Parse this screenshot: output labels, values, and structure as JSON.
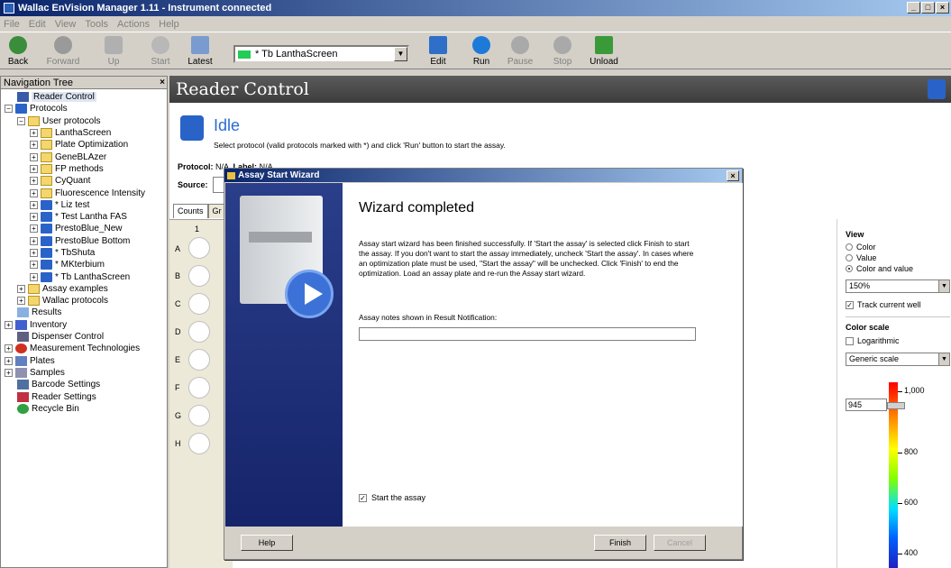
{
  "window": {
    "title": "Wallac EnVision Manager 1.11 - Instrument connected",
    "controls": [
      "_",
      "□",
      "×"
    ]
  },
  "menu": [
    "File",
    "Edit",
    "View",
    "Tools",
    "Actions",
    "Help"
  ],
  "toolbar": {
    "back": "Back",
    "forward": "Forward",
    "up": "Up",
    "start": "Start",
    "latest": "Latest",
    "protocol_select": "* Tb LanthaScreen",
    "edit": "Edit",
    "run": "Run",
    "pause": "Pause",
    "stop": "Stop",
    "unload": "Unload"
  },
  "nav": {
    "title": "Navigation Tree",
    "close": "×",
    "items": [
      {
        "label": "Reader Control"
      },
      {
        "label": "Protocols"
      },
      {
        "label": "User protocols"
      },
      {
        "label": "LanthaScreen"
      },
      {
        "label": "Plate Optimization"
      },
      {
        "label": "GeneBLAzer"
      },
      {
        "label": "FP methods"
      },
      {
        "label": "CyQuant"
      },
      {
        "label": "Fluorescence Intensity"
      },
      {
        "label": "* Liz test"
      },
      {
        "label": "* Test Lantha FAS"
      },
      {
        "label": "PrestoBlue_New"
      },
      {
        "label": "PrestoBlue Bottom"
      },
      {
        "label": "* TbShuta"
      },
      {
        "label": "* MKterbium"
      },
      {
        "label": "* Tb LanthaScreen"
      },
      {
        "label": "Assay examples"
      },
      {
        "label": "Wallac protocols"
      },
      {
        "label": "Results"
      },
      {
        "label": "Inventory"
      },
      {
        "label": "Dispenser Control"
      },
      {
        "label": "Measurement Technologies"
      },
      {
        "label": "Plates"
      },
      {
        "label": "Samples"
      },
      {
        "label": "Barcode Settings"
      },
      {
        "label": "Reader Settings"
      },
      {
        "label": "Recycle Bin"
      }
    ]
  },
  "main": {
    "header": "Reader Control",
    "status": "Idle",
    "status_text": "Select protocol (valid protocols marked with *) and click 'Run' button to start the assay.",
    "protocol_label": "Protocol:",
    "protocol_value": "N/A",
    "label_label": "Label:",
    "label_value": "N/A",
    "source_label": "Source:",
    "tabs": [
      "Counts",
      "Gr"
    ],
    "plate_col": "1",
    "plate_rows": [
      "A",
      "B",
      "C",
      "D",
      "E",
      "F",
      "G",
      "H"
    ]
  },
  "view_panel": {
    "title": "View",
    "options": [
      "Color",
      "Value",
      "Color and value"
    ],
    "selected": "Color and value",
    "zoom": "150%",
    "track": "Track current well",
    "color_scale_title": "Color scale",
    "logarithmic": "Logarithmic",
    "scale": "Generic scale",
    "slider_value": "945",
    "ticks": [
      "1,000",
      "800",
      "600",
      "400"
    ]
  },
  "wizard": {
    "title": "Assay Start Wizard",
    "close": "×",
    "heading": "Wizard completed",
    "message": "Assay start wizard has been finished successfully. If 'Start the assay' is selected click Finish to start the assay. If you don't want to start the assay immediately, uncheck 'Start the assay'. In cases where an optimization plate must be used, \"Start the assay\" will be unchecked. Click 'Finish' to end the optimization. Load an assay plate and re-run the Assay start wizard.",
    "notes_label": "Assay notes shown in Result Notification:",
    "notes_value": "",
    "start_checkbox": "Start the assay",
    "help": "Help",
    "finish": "Finish",
    "cancel": "Cancel"
  }
}
